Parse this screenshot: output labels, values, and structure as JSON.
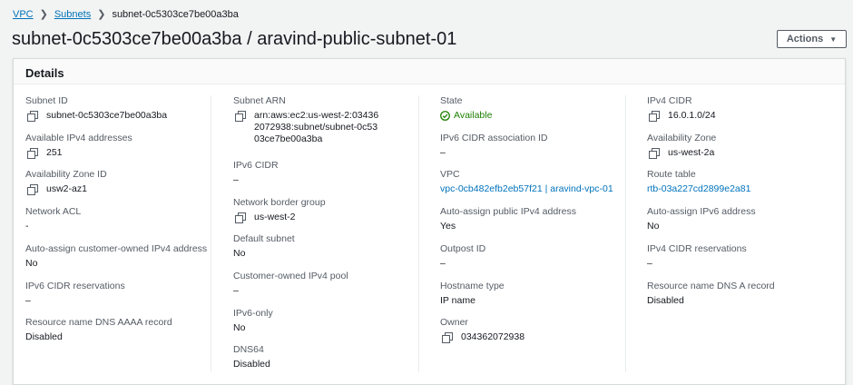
{
  "breadcrumb": {
    "vpc": "VPC",
    "subnets": "Subnets",
    "current": "subnet-0c5303ce7be00a3ba"
  },
  "page": {
    "title": "subnet-0c5303ce7be00a3ba / aravind-public-subnet-01",
    "actions_label": "Actions"
  },
  "details": {
    "header": "Details",
    "col1": {
      "subnet_id": {
        "label": "Subnet ID",
        "value": "subnet-0c5303ce7be00a3ba"
      },
      "available_ipv4": {
        "label": "Available IPv4 addresses",
        "value": "251"
      },
      "az_id": {
        "label": "Availability Zone ID",
        "value": "usw2-az1"
      },
      "network_acl": {
        "label": "Network ACL",
        "value": "-"
      },
      "auto_customer_owned": {
        "label": "Auto-assign customer-owned IPv4 address",
        "value": "No"
      },
      "ipv6_cidr_reservations": {
        "label": "IPv6 CIDR reservations",
        "value": "–"
      },
      "dns_aaaa": {
        "label": "Resource name DNS AAAA record",
        "value": "Disabled"
      }
    },
    "col2": {
      "subnet_arn": {
        "label": "Subnet ARN",
        "value": "arn:aws:ec2:us-west-2:034362072938:subnet/subnet-0c5303ce7be00a3ba"
      },
      "ipv6_cidr": {
        "label": "IPv6 CIDR",
        "value": "–"
      },
      "network_border_group": {
        "label": "Network border group",
        "value": "us-west-2"
      },
      "default_subnet": {
        "label": "Default subnet",
        "value": "No"
      },
      "customer_owned_pool": {
        "label": "Customer-owned IPv4 pool",
        "value": "–"
      },
      "ipv6_only": {
        "label": "IPv6-only",
        "value": "No"
      },
      "dns64": {
        "label": "DNS64",
        "value": "Disabled"
      }
    },
    "col3": {
      "state": {
        "label": "State",
        "value": "Available"
      },
      "ipv6_cidr_assoc": {
        "label": "IPv6 CIDR association ID",
        "value": "–"
      },
      "vpc": {
        "label": "VPC",
        "value": "vpc-0cb482efb2eb57f21 | aravind-vpc-01"
      },
      "auto_public_ipv4": {
        "label": "Auto-assign public IPv4 address",
        "value": "Yes"
      },
      "outpost_id": {
        "label": "Outpost ID",
        "value": "–"
      },
      "hostname_type": {
        "label": "Hostname type",
        "value": "IP name"
      },
      "owner": {
        "label": "Owner",
        "value": "034362072938"
      }
    },
    "col4": {
      "ipv4_cidr": {
        "label": "IPv4 CIDR",
        "value": "16.0.1.0/24"
      },
      "availability_zone": {
        "label": "Availability Zone",
        "value": "us-west-2a"
      },
      "route_table": {
        "label": "Route table",
        "value": "rtb-03a227cd2899e2a81"
      },
      "auto_ipv6": {
        "label": "Auto-assign IPv6 address",
        "value": "No"
      },
      "ipv4_cidr_reservations": {
        "label": "IPv4 CIDR reservations",
        "value": "–"
      },
      "dns_a": {
        "label": "Resource name DNS A record",
        "value": "Disabled"
      }
    }
  },
  "colors": {
    "link": "#0073bb",
    "success": "#1d8102",
    "label": "#545b64"
  },
  "icons": {
    "copy": "copy-icon",
    "status": "status-available-icon",
    "caret": "caret-down-icon",
    "breadcrumb_sep": "chevron-right-icon"
  }
}
